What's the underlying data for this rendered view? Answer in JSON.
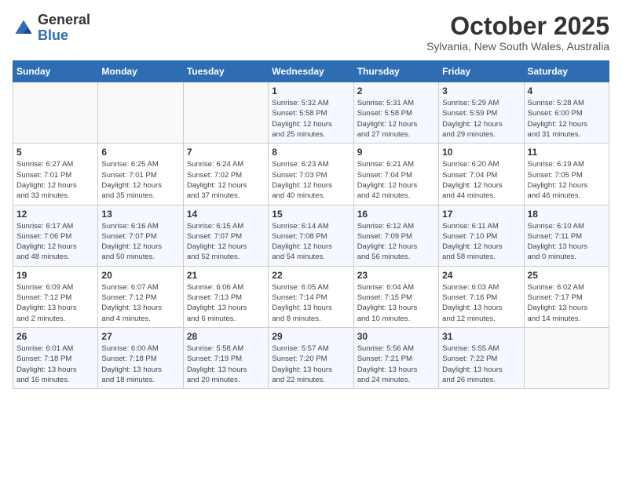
{
  "header": {
    "logo_general": "General",
    "logo_blue": "Blue",
    "month_title": "October 2025",
    "location": "Sylvania, New South Wales, Australia"
  },
  "weekdays": [
    "Sunday",
    "Monday",
    "Tuesday",
    "Wednesday",
    "Thursday",
    "Friday",
    "Saturday"
  ],
  "weeks": [
    [
      {
        "day": "",
        "info": ""
      },
      {
        "day": "",
        "info": ""
      },
      {
        "day": "",
        "info": ""
      },
      {
        "day": "1",
        "info": "Sunrise: 5:32 AM\nSunset: 5:58 PM\nDaylight: 12 hours\nand 25 minutes."
      },
      {
        "day": "2",
        "info": "Sunrise: 5:31 AM\nSunset: 5:58 PM\nDaylight: 12 hours\nand 27 minutes."
      },
      {
        "day": "3",
        "info": "Sunrise: 5:29 AM\nSunset: 5:59 PM\nDaylight: 12 hours\nand 29 minutes."
      },
      {
        "day": "4",
        "info": "Sunrise: 5:28 AM\nSunset: 6:00 PM\nDaylight: 12 hours\nand 31 minutes."
      }
    ],
    [
      {
        "day": "5",
        "info": "Sunrise: 6:27 AM\nSunset: 7:01 PM\nDaylight: 12 hours\nand 33 minutes."
      },
      {
        "day": "6",
        "info": "Sunrise: 6:25 AM\nSunset: 7:01 PM\nDaylight: 12 hours\nand 35 minutes."
      },
      {
        "day": "7",
        "info": "Sunrise: 6:24 AM\nSunset: 7:02 PM\nDaylight: 12 hours\nand 37 minutes."
      },
      {
        "day": "8",
        "info": "Sunrise: 6:23 AM\nSunset: 7:03 PM\nDaylight: 12 hours\nand 40 minutes."
      },
      {
        "day": "9",
        "info": "Sunrise: 6:21 AM\nSunset: 7:04 PM\nDaylight: 12 hours\nand 42 minutes."
      },
      {
        "day": "10",
        "info": "Sunrise: 6:20 AM\nSunset: 7:04 PM\nDaylight: 12 hours\nand 44 minutes."
      },
      {
        "day": "11",
        "info": "Sunrise: 6:19 AM\nSunset: 7:05 PM\nDaylight: 12 hours\nand 46 minutes."
      }
    ],
    [
      {
        "day": "12",
        "info": "Sunrise: 6:17 AM\nSunset: 7:06 PM\nDaylight: 12 hours\nand 48 minutes."
      },
      {
        "day": "13",
        "info": "Sunrise: 6:16 AM\nSunset: 7:07 PM\nDaylight: 12 hours\nand 50 minutes."
      },
      {
        "day": "14",
        "info": "Sunrise: 6:15 AM\nSunset: 7:07 PM\nDaylight: 12 hours\nand 52 minutes."
      },
      {
        "day": "15",
        "info": "Sunrise: 6:14 AM\nSunset: 7:08 PM\nDaylight: 12 hours\nand 54 minutes."
      },
      {
        "day": "16",
        "info": "Sunrise: 6:12 AM\nSunset: 7:09 PM\nDaylight: 12 hours\nand 56 minutes."
      },
      {
        "day": "17",
        "info": "Sunrise: 6:11 AM\nSunset: 7:10 PM\nDaylight: 12 hours\nand 58 minutes."
      },
      {
        "day": "18",
        "info": "Sunrise: 6:10 AM\nSunset: 7:11 PM\nDaylight: 13 hours\nand 0 minutes."
      }
    ],
    [
      {
        "day": "19",
        "info": "Sunrise: 6:09 AM\nSunset: 7:12 PM\nDaylight: 13 hours\nand 2 minutes."
      },
      {
        "day": "20",
        "info": "Sunrise: 6:07 AM\nSunset: 7:12 PM\nDaylight: 13 hours\nand 4 minutes."
      },
      {
        "day": "21",
        "info": "Sunrise: 6:06 AM\nSunset: 7:13 PM\nDaylight: 13 hours\nand 6 minutes."
      },
      {
        "day": "22",
        "info": "Sunrise: 6:05 AM\nSunset: 7:14 PM\nDaylight: 13 hours\nand 8 minutes."
      },
      {
        "day": "23",
        "info": "Sunrise: 6:04 AM\nSunset: 7:15 PM\nDaylight: 13 hours\nand 10 minutes."
      },
      {
        "day": "24",
        "info": "Sunrise: 6:03 AM\nSunset: 7:16 PM\nDaylight: 13 hours\nand 12 minutes."
      },
      {
        "day": "25",
        "info": "Sunrise: 6:02 AM\nSunset: 7:17 PM\nDaylight: 13 hours\nand 14 minutes."
      }
    ],
    [
      {
        "day": "26",
        "info": "Sunrise: 6:01 AM\nSunset: 7:18 PM\nDaylight: 13 hours\nand 16 minutes."
      },
      {
        "day": "27",
        "info": "Sunrise: 6:00 AM\nSunset: 7:18 PM\nDaylight: 13 hours\nand 18 minutes."
      },
      {
        "day": "28",
        "info": "Sunrise: 5:58 AM\nSunset: 7:19 PM\nDaylight: 13 hours\nand 20 minutes."
      },
      {
        "day": "29",
        "info": "Sunrise: 5:57 AM\nSunset: 7:20 PM\nDaylight: 13 hours\nand 22 minutes."
      },
      {
        "day": "30",
        "info": "Sunrise: 5:56 AM\nSunset: 7:21 PM\nDaylight: 13 hours\nand 24 minutes."
      },
      {
        "day": "31",
        "info": "Sunrise: 5:55 AM\nSunset: 7:22 PM\nDaylight: 13 hours\nand 26 minutes."
      },
      {
        "day": "",
        "info": ""
      }
    ]
  ]
}
